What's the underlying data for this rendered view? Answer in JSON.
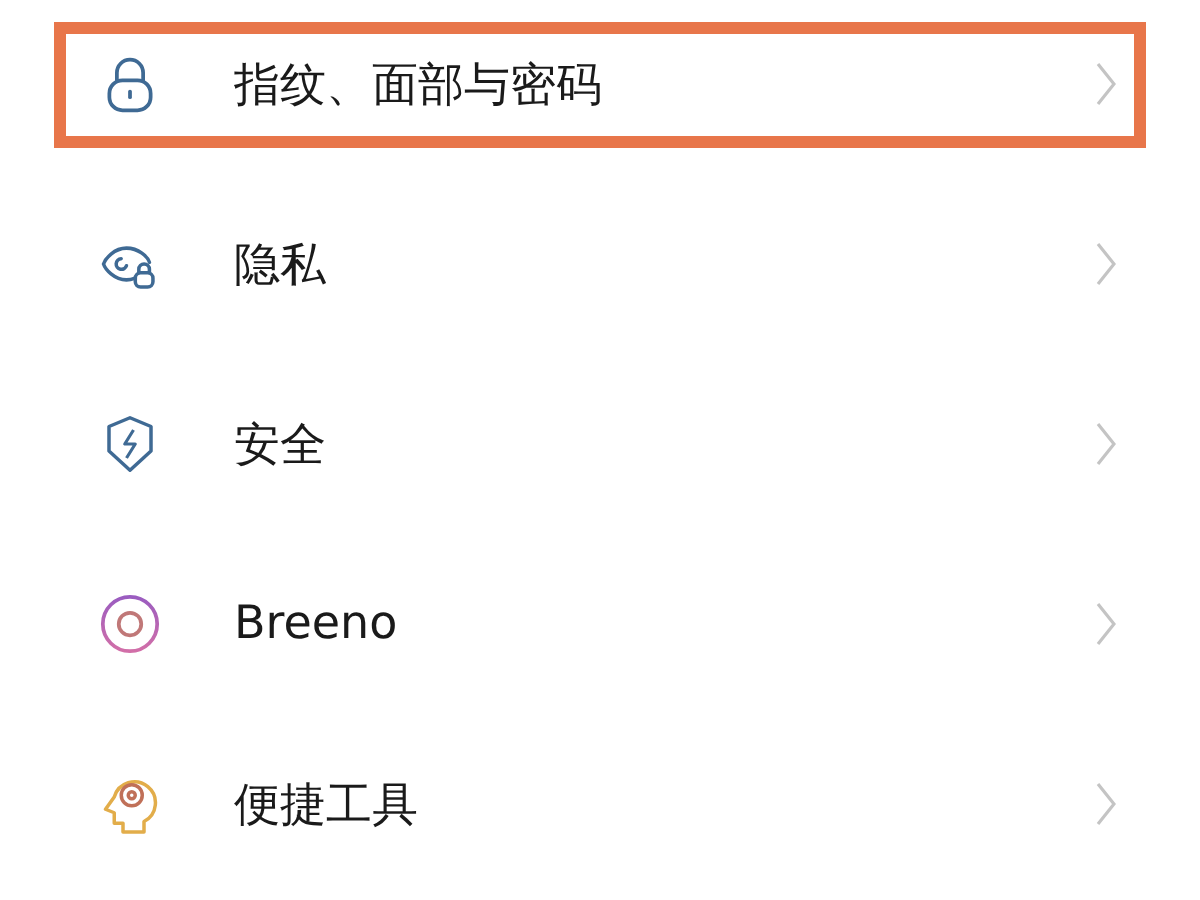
{
  "items": [
    {
      "kind": "lock",
      "label": "指纹、面部与密码",
      "highlighted": true
    },
    {
      "kind": "privacy",
      "label": "隐私",
      "highlighted": false
    },
    {
      "kind": "security",
      "label": "安全",
      "highlighted": false
    },
    {
      "kind": "assistant",
      "label": "Breeno",
      "highlighted": false
    },
    {
      "kind": "tools",
      "label": "便捷工具",
      "highlighted": false
    }
  ]
}
